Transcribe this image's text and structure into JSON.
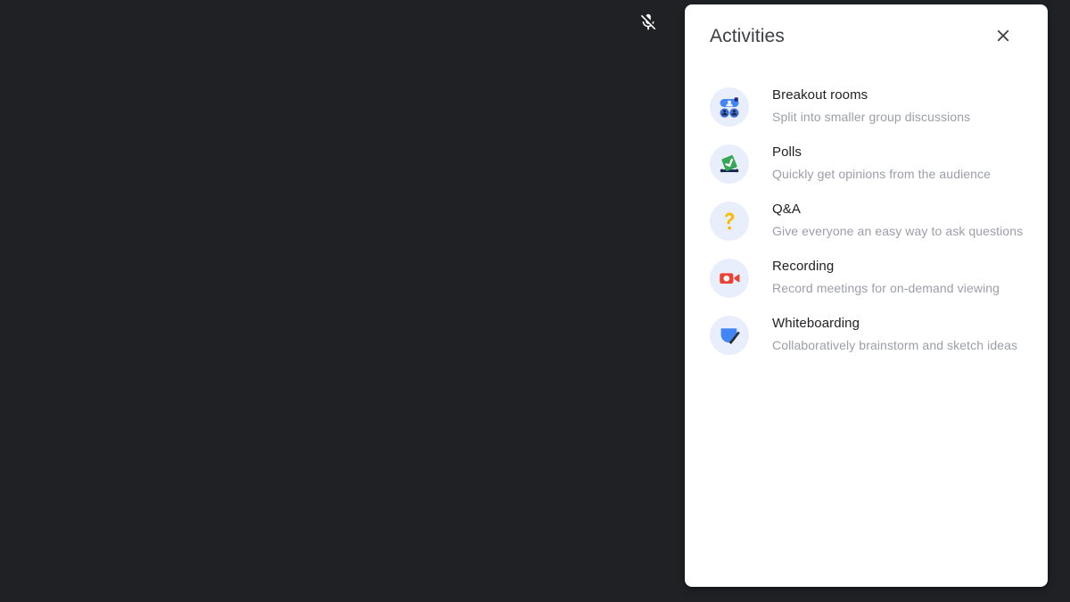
{
  "meta": {
    "app": "video-meeting",
    "background_color": "#202124",
    "panel_background": "#ffffff",
    "icon_circle_color": "#e8eefc"
  },
  "stage": {
    "mic_status_icon": "mic-off-icon",
    "mic_status_label": "Microphone muted"
  },
  "panel": {
    "title": "Activities",
    "close_label": "Close",
    "close_icon": "close-icon",
    "items": [
      {
        "icon": "breakout-rooms-icon",
        "title": "Breakout rooms",
        "description": "Split into smaller group discussions",
        "accent": "#4285f4"
      },
      {
        "icon": "polls-icon",
        "title": "Polls",
        "description": "Quickly get opinions from the audience",
        "accent": "#34a853"
      },
      {
        "icon": "qa-icon",
        "title": "Q&A",
        "description": "Give everyone an easy way to ask questions",
        "accent": "#fbbc04"
      },
      {
        "icon": "recording-icon",
        "title": "Recording",
        "description": "Record meetings for on-demand viewing",
        "accent": "#ea4335"
      },
      {
        "icon": "whiteboarding-icon",
        "title": "Whiteboarding",
        "description": "Collaboratively brainstorm and sketch ideas",
        "accent": "#4285f4"
      }
    ]
  }
}
